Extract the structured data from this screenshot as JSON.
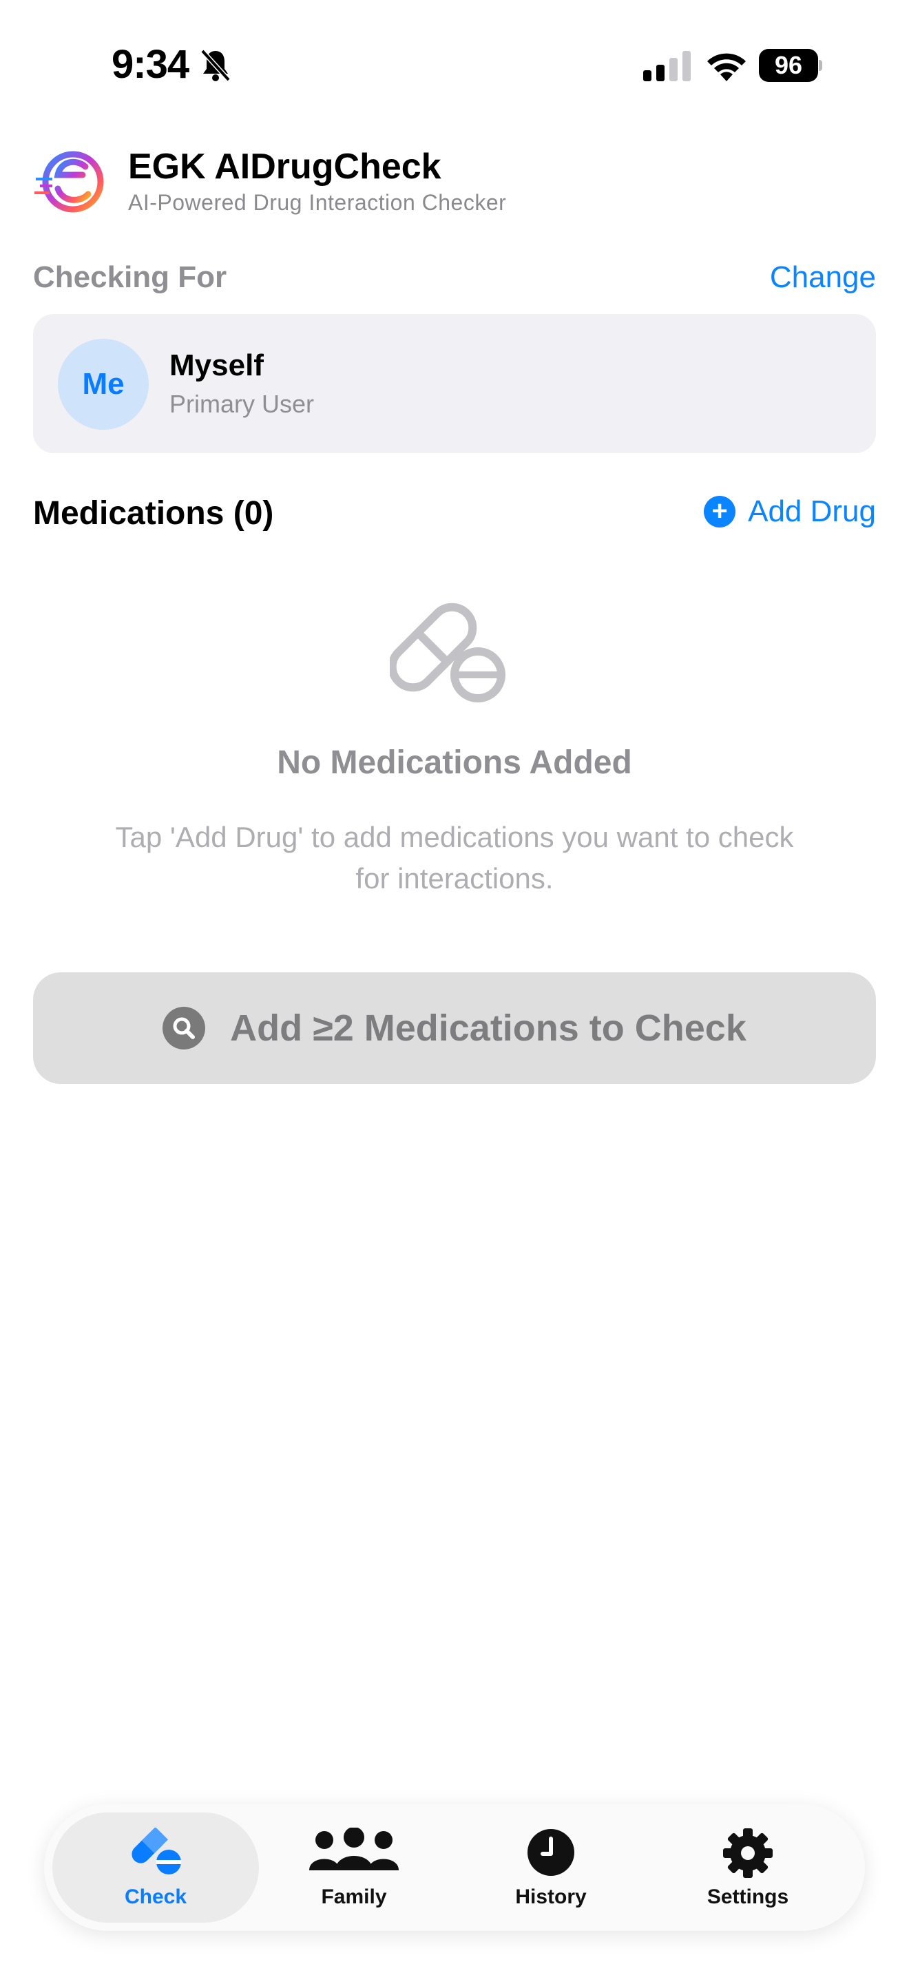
{
  "status_bar": {
    "time": "9:34",
    "battery": "96"
  },
  "header": {
    "title": "EGK AIDrugCheck",
    "subtitle": "AI-Powered Drug Interaction Checker"
  },
  "checking_for": {
    "label": "Checking For",
    "change_label": "Change",
    "profile": {
      "avatar_text": "Me",
      "name": "Myself",
      "role": "Primary User"
    }
  },
  "medications": {
    "title": "Medications (0)",
    "add_label": "Add Drug",
    "empty_title": "No Medications Added",
    "empty_description": "Tap 'Add Drug' to add medications you want to check for interactions."
  },
  "check_button": {
    "label": "Add ≥2 Medications to Check"
  },
  "tabs": [
    {
      "label": "Check",
      "icon": "pills-icon",
      "active": true
    },
    {
      "label": "Family",
      "icon": "people-icon",
      "active": false
    },
    {
      "label": "History",
      "icon": "clock-icon",
      "active": false
    },
    {
      "label": "Settings",
      "icon": "gear-icon",
      "active": false
    }
  ],
  "colors": {
    "accent": "#0a84ff",
    "secondary_text": "#8e8e93",
    "card_background": "#f0f0f5",
    "disabled_button": "#dedede"
  }
}
